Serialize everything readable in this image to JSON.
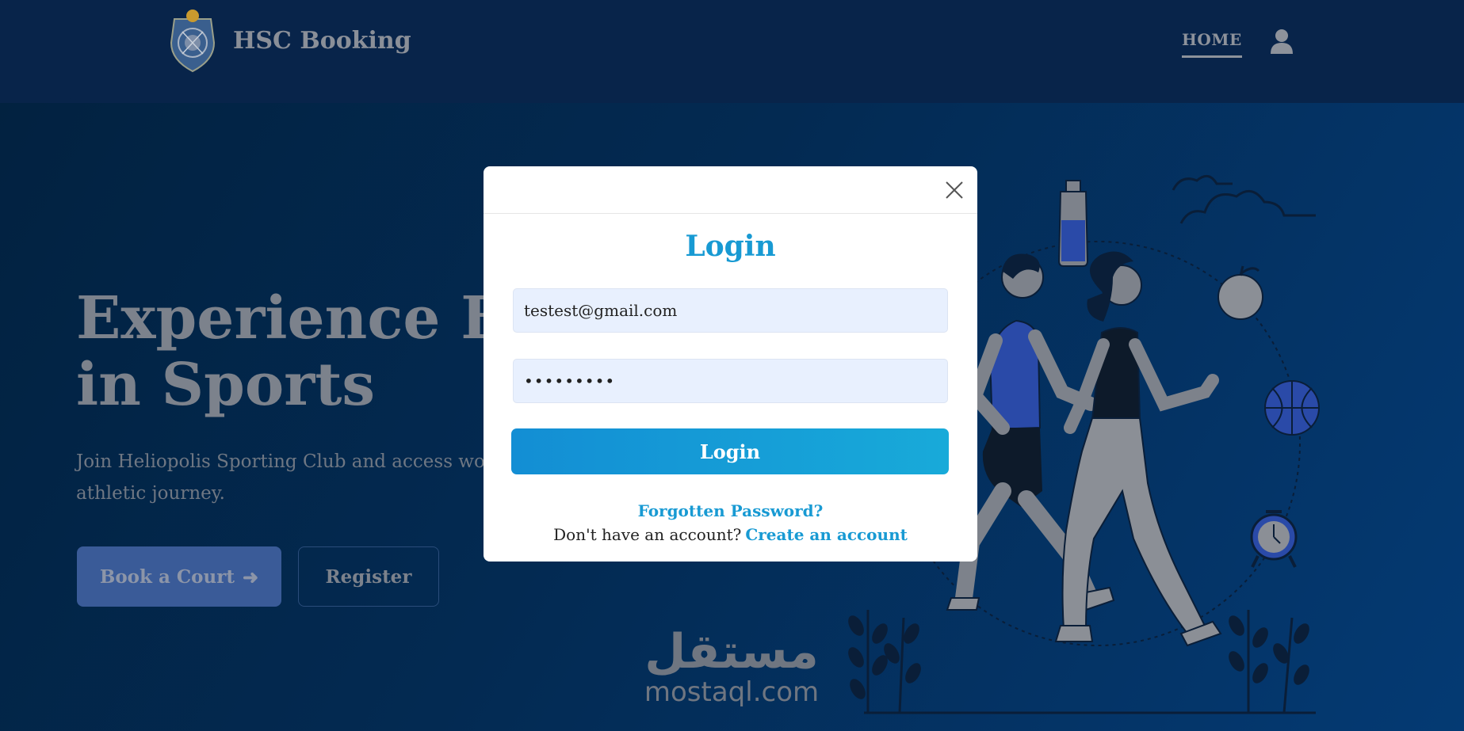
{
  "navbar": {
    "brand_name": "HSC Booking",
    "logo_icon": "club-crest-logo",
    "links": {
      "home": "HOME"
    },
    "user_icon": "user-icon"
  },
  "hero": {
    "title_line1": "Experience Ex",
    "title_line2": "in Sports",
    "subtitle_line1": "Join Heliopolis Sporting Club and access worl",
    "subtitle_line2": "athletic journey.",
    "book_button": "Book a Court",
    "book_button_icon": "arrow-right-icon",
    "register_button": "Register"
  },
  "modal": {
    "title": "Login",
    "email_value": "testest@gmail.com",
    "password_value": "•••••••••",
    "login_button": "Login",
    "forgot_link": "Forgotten Password?",
    "signup_text": "Don't have an account?",
    "signup_link": "Create an account",
    "close_icon": "close-icon"
  },
  "watermark": {
    "arabic": "مستقل",
    "latin": "mostaql.com"
  },
  "colors": {
    "accent": "#189ad3",
    "navbar_bg": "#08244a",
    "page_bg": "#032a52",
    "modal_bg": "#ffffff",
    "field_bg": "#e8f0fe"
  }
}
